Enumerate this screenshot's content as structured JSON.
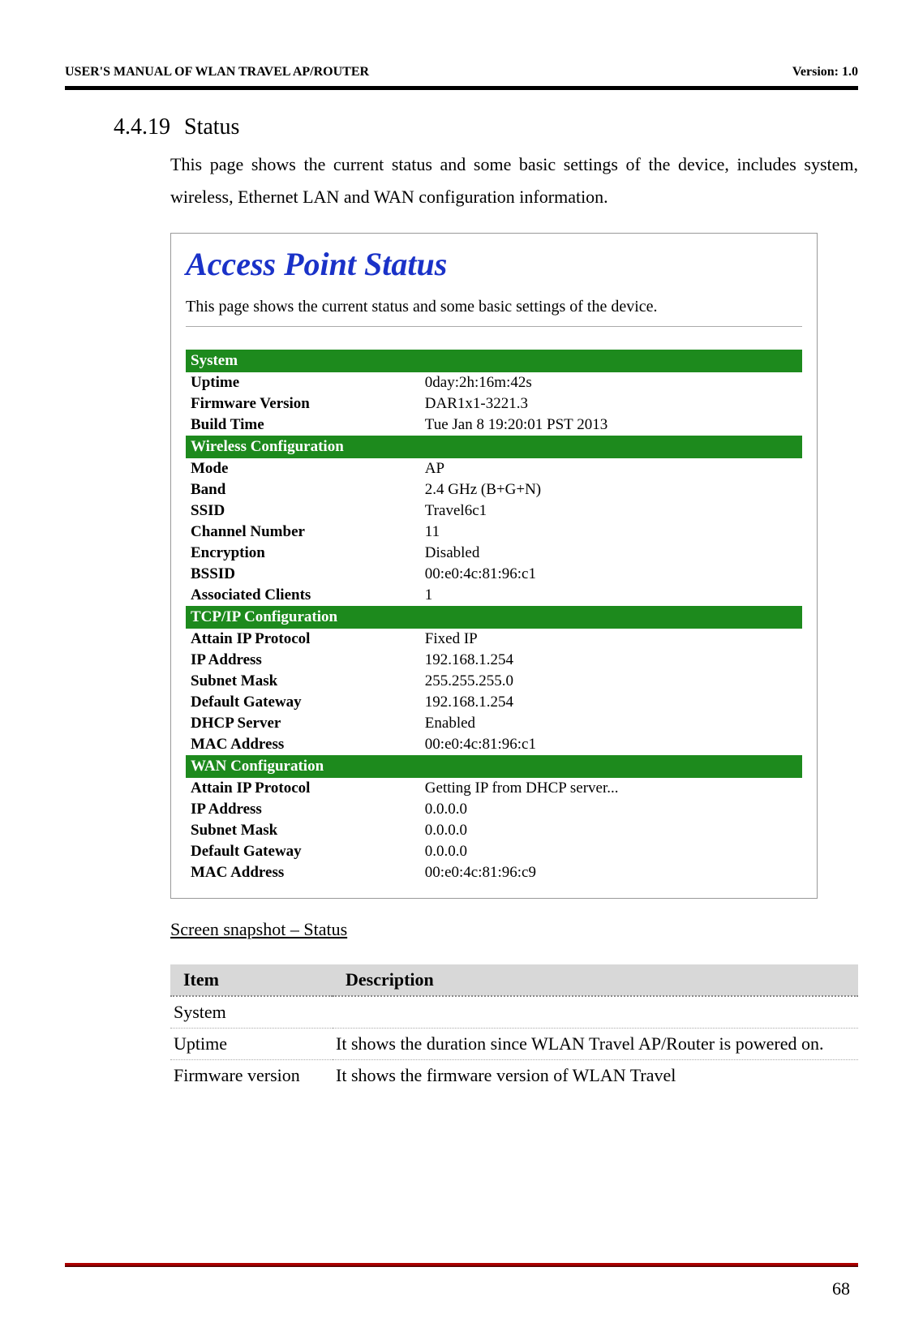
{
  "doc_header": {
    "left": "USER'S MANUAL OF WLAN TRAVEL AP/ROUTER",
    "right": "Version: 1.0"
  },
  "section": {
    "number": "4.4.19",
    "title": "Status",
    "body": "This page shows the current status and some basic settings of the device, includes system, wireless, Ethernet LAN and WAN configuration information."
  },
  "screenshot": {
    "title": "Access Point Status",
    "intro": "This page shows the current status and some basic settings of the device.",
    "groups": [
      {
        "header": "System",
        "rows": [
          {
            "label": "Uptime",
            "value": "0day:2h:16m:42s"
          },
          {
            "label": "Firmware Version",
            "value": "DAR1x1-3221.3"
          },
          {
            "label": "Build Time",
            "value": "Tue Jan 8 19:20:01 PST 2013"
          }
        ]
      },
      {
        "header": "Wireless Configuration",
        "rows": [
          {
            "label": "Mode",
            "value": "AP"
          },
          {
            "label": "Band",
            "value": "2.4 GHz (B+G+N)"
          },
          {
            "label": "SSID",
            "value": "Travel6c1"
          },
          {
            "label": "Channel Number",
            "value": "11"
          },
          {
            "label": "Encryption",
            "value": "Disabled"
          },
          {
            "label": "BSSID",
            "value": "00:e0:4c:81:96:c1"
          },
          {
            "label": "Associated Clients",
            "value": "1"
          }
        ]
      },
      {
        "header": "TCP/IP Configuration",
        "rows": [
          {
            "label": "Attain IP Protocol",
            "value": "Fixed IP"
          },
          {
            "label": "IP Address",
            "value": "192.168.1.254"
          },
          {
            "label": "Subnet Mask",
            "value": "255.255.255.0"
          },
          {
            "label": "Default Gateway",
            "value": "192.168.1.254"
          },
          {
            "label": "DHCP Server",
            "value": "Enabled"
          },
          {
            "label": "MAC Address",
            "value": "00:e0:4c:81:96:c1"
          }
        ]
      },
      {
        "header": "WAN Configuration",
        "rows": [
          {
            "label": "Attain IP Protocol",
            "value": "Getting IP from DHCP server..."
          },
          {
            "label": "IP Address",
            "value": "0.0.0.0"
          },
          {
            "label": "Subnet Mask",
            "value": "0.0.0.0"
          },
          {
            "label": "Default Gateway",
            "value": "0.0.0.0"
          },
          {
            "label": "MAC Address",
            "value": "00:e0:4c:81:96:c9"
          }
        ]
      }
    ]
  },
  "caption": "Screen snapshot – Status",
  "desc_table": {
    "headers": {
      "item": "Item",
      "description": "Description"
    },
    "rows": [
      {
        "item": "System",
        "description": ""
      },
      {
        "item": "Uptime",
        "description": "It shows the duration since WLAN Travel AP/Router is powered on."
      },
      {
        "item": "Firmware version",
        "description": "It shows the firmware version of WLAN Travel"
      }
    ]
  },
  "page_number": "68"
}
